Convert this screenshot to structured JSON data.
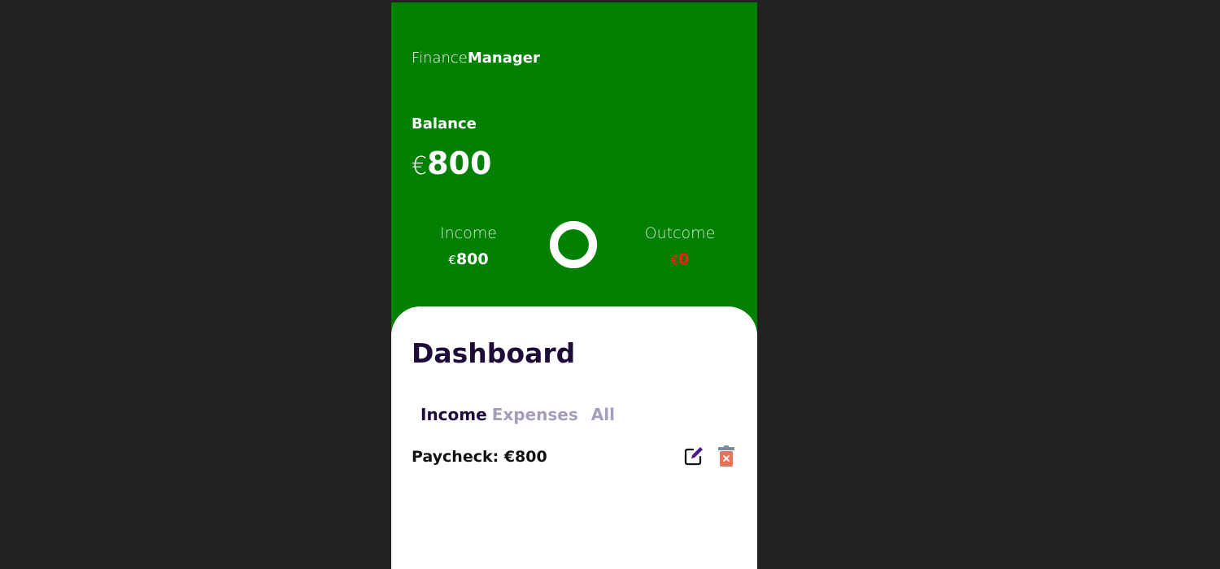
{
  "brand": {
    "light": "Finance",
    "bold": "Manager"
  },
  "balance": {
    "label": "Balance",
    "currency": "€",
    "amount": "800"
  },
  "income": {
    "label": "Income",
    "currency": "€",
    "amount": "800"
  },
  "outcome": {
    "label": "Outcome",
    "currency": "€",
    "amount": "0"
  },
  "ratio_ring": {
    "income_share": 1.0,
    "color": "#ffffff"
  },
  "dashboard": {
    "title": "Dashboard",
    "tabs": [
      {
        "label": "Income",
        "active": true
      },
      {
        "label": "Expenses",
        "active": false
      },
      {
        "label": "All",
        "active": false
      }
    ],
    "transactions": [
      {
        "label": "Paycheck: €800",
        "edit_icon": "edit-icon",
        "delete_icon": "trash-icon"
      }
    ]
  },
  "colors": {
    "header_bg": "#028002",
    "page_bg": "#222222",
    "title_text": "#1e0b3a",
    "inactive_tab": "#a89db8",
    "outcome_value": "#ff1a1a",
    "edit_accent": "#4a1a8c",
    "trash_body": "#e8735a",
    "trash_lid": "#7a8a96"
  }
}
